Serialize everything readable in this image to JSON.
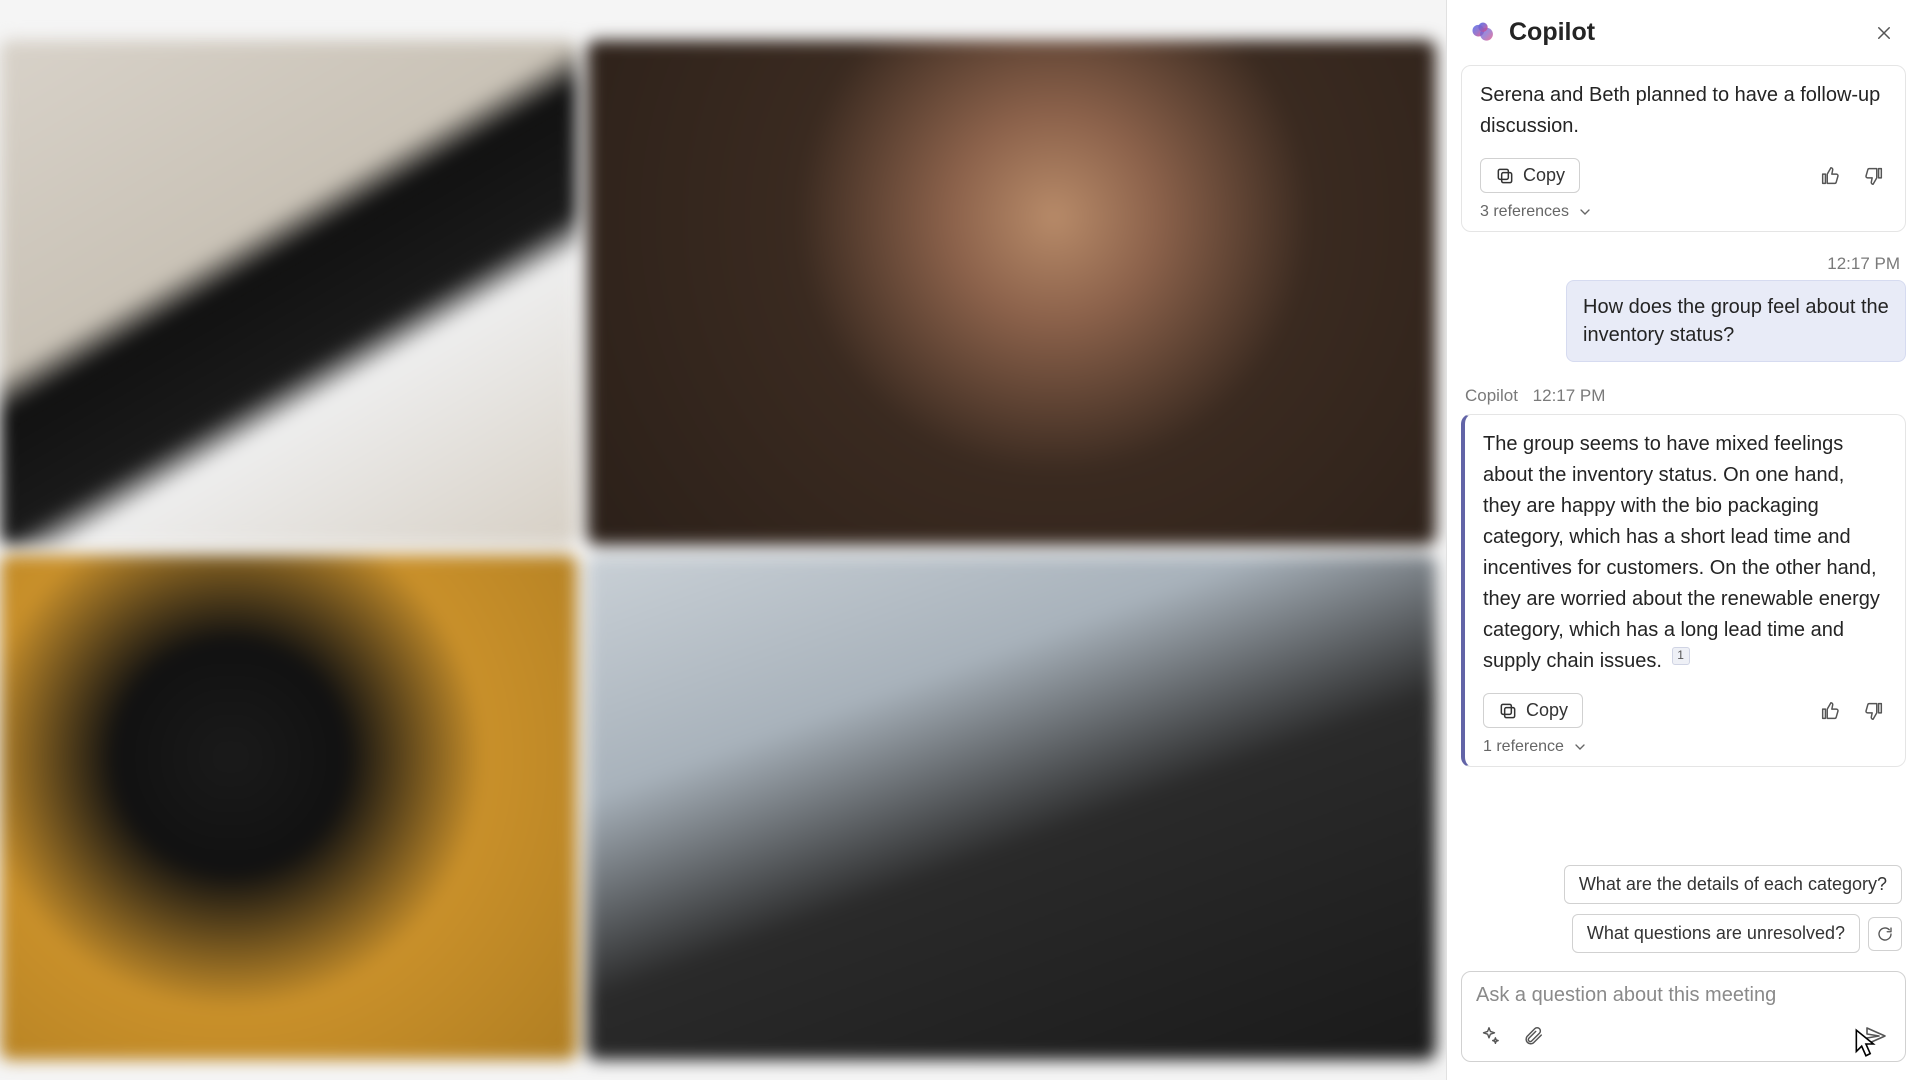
{
  "header": {
    "title": "Copilot"
  },
  "messages": {
    "prev_response": {
      "partial_text": "Serena and Beth planned to have a follow-up discussion.",
      "copy_label": "Copy",
      "references_label": "3 references"
    },
    "user_query": {
      "timestamp": "12:17 PM",
      "text": "How does the group feel about the inventory status?"
    },
    "copilot_response": {
      "sender": "Copilot",
      "timestamp": "12:17 PM",
      "text": "The group seems to have mixed feelings about the inventory status. On one hand, they are happy with the bio packaging category, which has a short lead time and incentives for customers. On the other hand, they are worried about the renewable energy category, which has a long lead time and supply chain issues.",
      "citation": "1",
      "copy_label": "Copy",
      "references_label": "1 reference"
    }
  },
  "suggestions": {
    "s1": "What are the details of each category?",
    "s2": "What questions are unresolved?"
  },
  "composer": {
    "placeholder": "Ask a question about this meeting"
  }
}
